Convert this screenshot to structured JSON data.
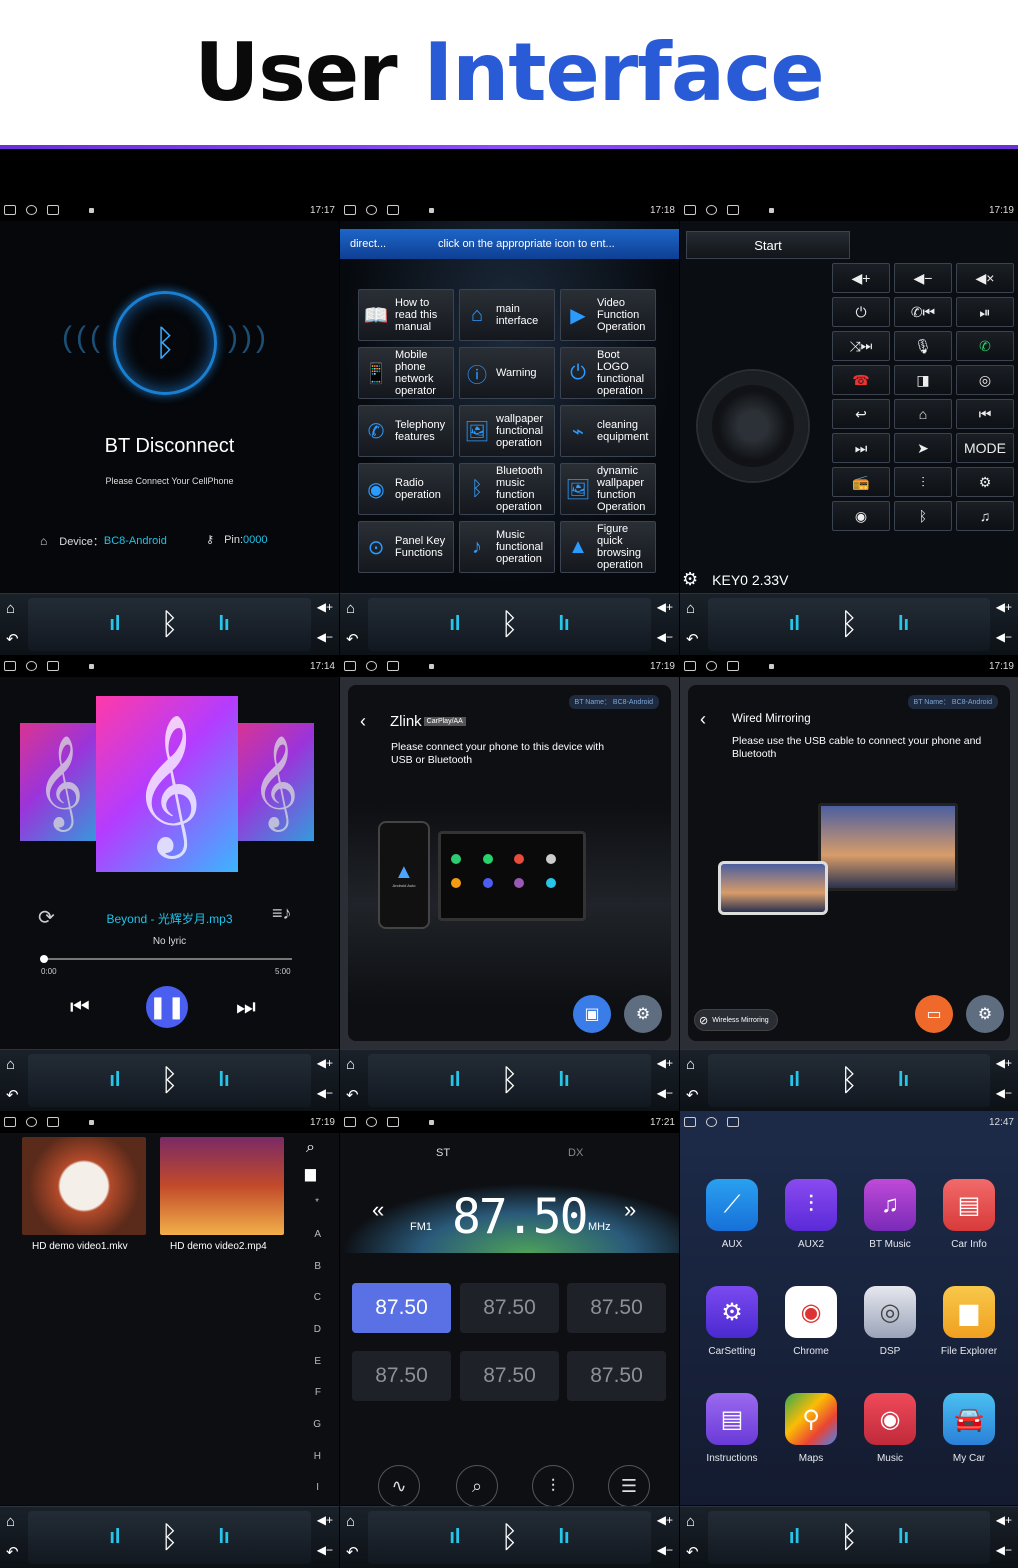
{
  "header": {
    "title_word1": "User",
    "title_word2": "Interface"
  },
  "dock": {
    "call_icon": "call-icon",
    "bt_icon": "bluetooth-icon"
  },
  "panels": {
    "bt": {
      "time": "17:17",
      "title": "BT Disconnect",
      "subtitle": "Please Connect Your CellPhone",
      "device_label": "Device：",
      "device_value": "BC8-Android",
      "pin_label": "Pin:",
      "pin_value": "0000",
      "accent": "#1ec3e8"
    },
    "manual": {
      "time": "17:18",
      "tab1": "direct...",
      "tab2": "click on the appropriate icon to ent...",
      "items": [
        "How to read this manual",
        "main interface",
        "Video Function Operation",
        "Mobile phone network operator",
        "Warning",
        "Boot LOGO functional operation",
        "Telephony features",
        "wallpaper functional operation",
        "cleaning equipment",
        "Radio operation",
        "Bluetooth music function operation",
        "dynamic wallpaper function Operation",
        "Panel Key Functions",
        "Music functional operation",
        "Figure quick browsing operation"
      ]
    },
    "keys": {
      "time": "17:19",
      "start": "Start",
      "key_readout": "KEY0 2.33V",
      "mode": "MODE"
    },
    "music": {
      "time": "17:14",
      "song": "Beyond - 光辉岁月.mp3",
      "lyric": "No lyric",
      "elapsed": "0:00",
      "total": "5:00",
      "progress": 0.0
    },
    "zlink": {
      "time": "17:19",
      "bt_name": "BT Name：  BC8-Android",
      "title": "Zlink",
      "tag": "CarPlay/AA",
      "text": "Please connect your phone to this device with USB or Bluetooth",
      "phone_label": "Android Auto"
    },
    "wired": {
      "time": "17:19",
      "bt_name": "BT Name：  BC8-Android",
      "title": "Wired Mirroring",
      "text": "Please use the USB cable to connect your phone and Bluetooth",
      "wireless": "Wireless Mirroring"
    },
    "video": {
      "time": "17:19",
      "files": [
        "HD demo video1.mkv",
        "HD demo video2.mp4"
      ],
      "letters": [
        "A",
        "B",
        "C",
        "D",
        "E",
        "F",
        "G",
        "H",
        "I"
      ],
      "star": "*"
    },
    "radio": {
      "time": "17:21",
      "st": "ST",
      "dx": "DX",
      "band": "FM1",
      "freq": "87.50",
      "unit": "MHz",
      "presets": [
        "87.50",
        "87.50",
        "87.50",
        "87.50",
        "87.50",
        "87.50"
      ]
    },
    "apps": {
      "time": "12:47",
      "items": [
        "AUX",
        "AUX2",
        "BT Music",
        "Car Info",
        "CarSetting",
        "Chrome",
        "DSP",
        "File Explorer",
        "Instructions",
        "Maps",
        "Music",
        "My Car"
      ]
    }
  }
}
